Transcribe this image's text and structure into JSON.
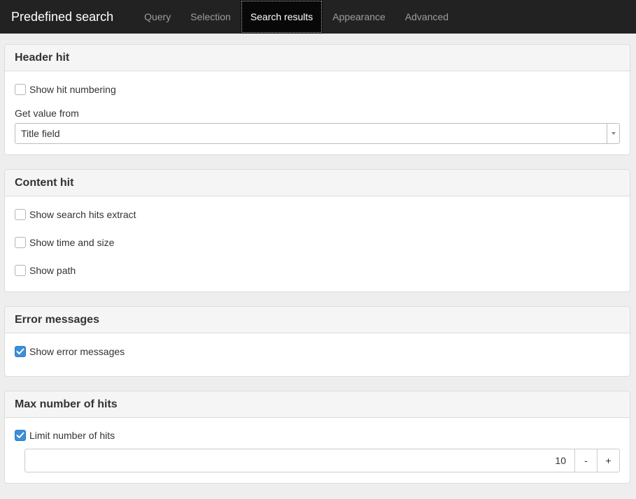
{
  "navbar": {
    "brand": "Predefined search",
    "tabs": [
      {
        "label": "Query",
        "active": false
      },
      {
        "label": "Selection",
        "active": false
      },
      {
        "label": "Search results",
        "active": true
      },
      {
        "label": "Appearance",
        "active": false
      },
      {
        "label": "Advanced",
        "active": false
      }
    ]
  },
  "panels": {
    "header_hit": {
      "title": "Header hit",
      "show_hit_numbering": {
        "label": "Show hit numbering",
        "checked": false
      },
      "get_value_label": "Get value from",
      "get_value_selected": "Title field"
    },
    "content_hit": {
      "title": "Content hit",
      "options": [
        {
          "label": "Show search hits extract",
          "checked": false
        },
        {
          "label": "Show time and size",
          "checked": false
        },
        {
          "label": "Show path",
          "checked": false
        }
      ]
    },
    "error_messages": {
      "title": "Error messages",
      "show_error_messages": {
        "label": "Show error messages",
        "checked": true
      }
    },
    "max_hits": {
      "title": "Max number of hits",
      "limit_hits": {
        "label": "Limit number of hits",
        "checked": true
      },
      "value": "10",
      "decrement_label": "-",
      "increment_label": "+"
    }
  },
  "colors": {
    "navbar_bg": "#222222",
    "checkbox_checked": "#3b8fd9"
  }
}
